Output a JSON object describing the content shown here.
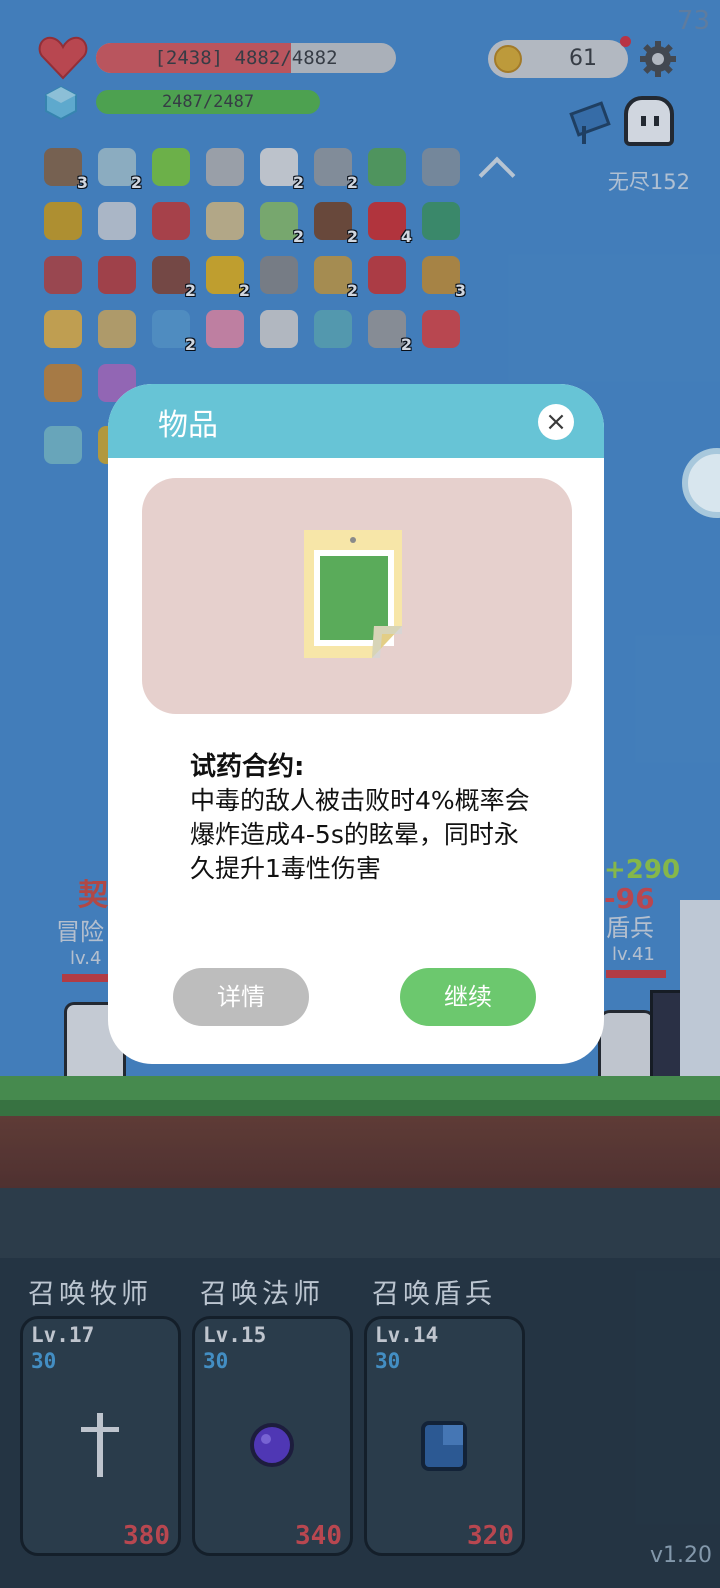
{
  "hud": {
    "hp_text": "[2438] 4882/4882",
    "hp_fraction": 0.65,
    "mp_text": "2487/2487",
    "mp_fraction": 1.0,
    "coins": "61",
    "fps": "73",
    "endless_label": "无尽152",
    "version": "v1.20"
  },
  "inventory": [
    {
      "icon": "shield-icon",
      "color": "#8c6a4a",
      "count": "3"
    },
    {
      "icon": "syringe-icon",
      "color": "#a7c9d8",
      "count": "2"
    },
    {
      "icon": "lime-icon",
      "color": "#7fcf3f",
      "count": ""
    },
    {
      "icon": "compass-icon",
      "color": "#b9b9b9",
      "count": ""
    },
    {
      "icon": "flower-icon",
      "color": "#e6e6e6",
      "count": "2"
    },
    {
      "icon": "sword-icon",
      "color": "#9aa0a6",
      "count": "2"
    },
    {
      "icon": "contract-icon",
      "color": "#5aab5a",
      "count": ""
    },
    {
      "icon": "magnifier-icon",
      "color": "#8a9aa8",
      "count": ""
    },
    {
      "icon": "chevron-up-icon",
      "color": "#dfe8ef",
      "count": ""
    },
    {
      "icon": "pineapple-icon",
      "color": "#d4a421",
      "count": ""
    },
    {
      "icon": "card-icon",
      "color": "#cfd6df",
      "count": ""
    },
    {
      "icon": "thermometer-icon",
      "color": "#c94040",
      "count": ""
    },
    {
      "icon": "map-icon",
      "color": "#d9c38f",
      "count": ""
    },
    {
      "icon": "potion-icon",
      "color": "#8dc36f",
      "count": "2"
    },
    {
      "icon": "coconut-icon",
      "color": "#7a4a2e",
      "count": "2"
    },
    {
      "icon": "apple-icon",
      "color": "#d83030",
      "count": "4"
    },
    {
      "icon": "tent-icon",
      "color": "#3f9b6a",
      "count": ""
    },
    {
      "icon": "gauntlet-icon",
      "color": "#b94848",
      "count": ""
    },
    {
      "icon": "hook-icon",
      "color": "#c04040",
      "count": ""
    },
    {
      "icon": "tombstone-icon",
      "color": "#8a4a3a",
      "count": "2"
    },
    {
      "icon": "sunflower-icon",
      "color": "#e9b81e",
      "count": "2"
    },
    {
      "icon": "tools-icon",
      "color": "#8c8c8c",
      "count": ""
    },
    {
      "icon": "scroll-icon",
      "color": "#c8a04a",
      "count": "2"
    },
    {
      "icon": "bookmark-icon",
      "color": "#d03a3a",
      "count": ""
    },
    {
      "icon": "book-icon",
      "color": "#c9953a",
      "count": "3"
    },
    {
      "icon": "beer-icon",
      "color": "#e9b84a",
      "count": ""
    },
    {
      "icon": "parchment-icon",
      "color": "#d4b26a",
      "count": ""
    },
    {
      "icon": "speech-bubble-icon",
      "color": "#5aa0d8",
      "count": "2"
    },
    {
      "icon": "ice-cream-icon",
      "color": "#e890b0",
      "count": ""
    },
    {
      "icon": "dots-icon",
      "color": "#d8d8d8",
      "count": ""
    },
    {
      "icon": "target-icon",
      "color": "#5fb0c0",
      "count": ""
    },
    {
      "icon": "meteor-icon",
      "color": "#a0a0a0",
      "count": "2"
    },
    {
      "icon": "watermelon-icon",
      "color": "#e04848",
      "count": ""
    },
    {
      "icon": "briefcase-icon",
      "color": "#c98a3a",
      "count": ""
    },
    {
      "icon": "potted-flower-icon",
      "color": "#b070c8",
      "count": ""
    },
    {
      "icon": "portrait-icon",
      "color": "#7ac0d0",
      "count": ""
    },
    {
      "icon": "relic-icon",
      "color": "#d8b030",
      "count": ""
    }
  ],
  "battle": {
    "left_name": "契",
    "left_role": "冒险",
    "left_level": "lv.4",
    "right_dmg1": "+290",
    "right_dmg2": "-96",
    "right_role": "盾兵",
    "right_level": "lv.41"
  },
  "modal": {
    "title": "物品",
    "close": "×",
    "item_name": "试药合约:",
    "item_desc": "中毒的敌人被击败时4%概率会爆炸造成4-5s的眩晕，同时永久提升1毒性伤害",
    "detail_button": "详情",
    "continue_button": "继续"
  },
  "summons": [
    {
      "label": "召唤牧师",
      "level": "Lv.17",
      "mana": "30",
      "cost": "380",
      "icon": "cross-icon"
    },
    {
      "label": "召唤法师",
      "level": "Lv.15",
      "mana": "30",
      "cost": "340",
      "icon": "orb-icon"
    },
    {
      "label": "召唤盾兵",
      "level": "Lv.14",
      "mana": "30",
      "cost": "320",
      "icon": "shield-block-icon"
    }
  ],
  "colors": {
    "modal_header": "#67c4d6",
    "continue": "#6cc86e",
    "detail": "#bdbdbd",
    "hp": "#e24a4a",
    "mp": "#5cc04a"
  }
}
